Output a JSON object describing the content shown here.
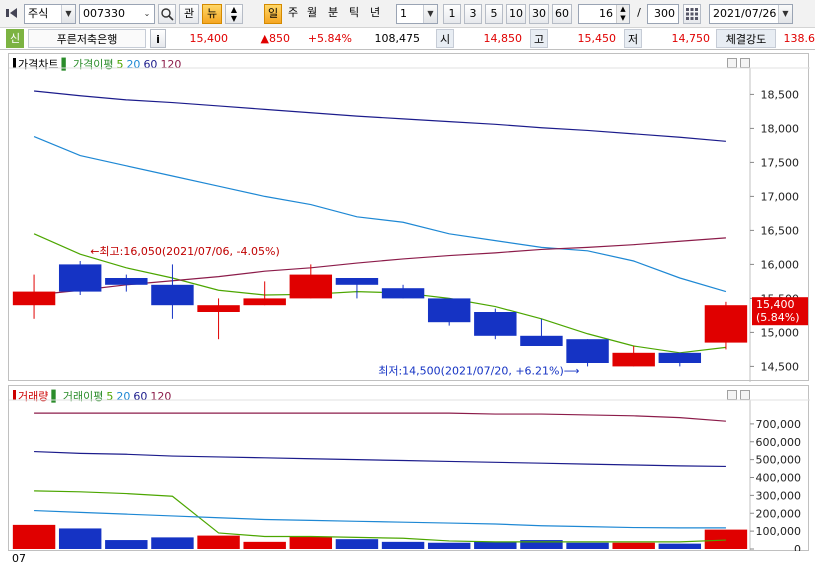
{
  "toolbar": {
    "market_type": "주식",
    "stock_code": "007330",
    "search_icon": "search-icon",
    "btn_gwan": "관",
    "btn_nyu": "뉴",
    "period_tabs": [
      {
        "label": "일",
        "active": true
      },
      {
        "label": "주",
        "active": false
      },
      {
        "label": "월",
        "active": false
      },
      {
        "label": "분",
        "active": false
      },
      {
        "label": "틱",
        "active": false
      },
      {
        "label": "년",
        "active": false
      }
    ],
    "interval_value": "1",
    "interval_buttons": [
      "1",
      "3",
      "5",
      "10",
      "30",
      "60"
    ],
    "count_value": "16",
    "slash": "/",
    "total_value": "300",
    "date_value": "2021/07/26"
  },
  "quote": {
    "badge": "신",
    "stock_name": "푸른저축은행",
    "info_button": "i",
    "price": "15,400",
    "change": "▲850",
    "change_rate": "+5.84%",
    "volume": "108,475",
    "open_label": "시",
    "open_value": "14,850",
    "high_label": "고",
    "high_value": "15,450",
    "low_label": "저",
    "low_value": "14,750",
    "strength_label": "체결강도",
    "strength_value": "138.6"
  },
  "price_chart": {
    "legend": {
      "title": "가격차트",
      "ma_label": "가격이평",
      "ma_periods": [
        "5",
        "20",
        "60",
        "120"
      ]
    },
    "y_ticks": [
      "18,500",
      "18,000",
      "17,500",
      "17,000",
      "16,500",
      "16,000",
      "15,500",
      "15,000",
      "14,500"
    ],
    "current_price_label": "15,400",
    "current_rate_label": "(5.84%)",
    "high_annotation": "←최고:16,050(2021/07/06, -4.05%)",
    "low_annotation": "최저:14,500(2021/07/20, +6.21%)⟶"
  },
  "volume_chart": {
    "legend": {
      "title": "거래량",
      "ma_label": "거래이평",
      "ma_periods": [
        "5",
        "20",
        "60",
        "120"
      ]
    },
    "y_ticks": [
      "700,000",
      "600,000",
      "500,000",
      "400,000",
      "300,000",
      "200,000",
      "100,000",
      "0"
    ]
  },
  "x_axis": {
    "month_label": "07"
  },
  "chart_data": {
    "type": "candlestick",
    "y_range": [
      14300,
      18800
    ],
    "candles": [
      {
        "open": 15400,
        "high": 15850,
        "low": 15200,
        "close": 15600,
        "volume": 135000
      },
      {
        "open": 16000,
        "high": 16050,
        "low": 15550,
        "close": 15600,
        "volume": 115000
      },
      {
        "open": 15800,
        "high": 15850,
        "low": 15600,
        "close": 15700,
        "volume": 50000
      },
      {
        "open": 15700,
        "high": 16000,
        "low": 15200,
        "close": 15400,
        "volume": 65000
      },
      {
        "open": 15300,
        "high": 15500,
        "low": 14900,
        "close": 15400,
        "volume": 75000
      },
      {
        "open": 15400,
        "high": 15750,
        "low": 15400,
        "close": 15500,
        "volume": 40000
      },
      {
        "open": 15500,
        "high": 16000,
        "low": 15500,
        "close": 15850,
        "volume": 70000
      },
      {
        "open": 15800,
        "high": 15800,
        "low": 15500,
        "close": 15700,
        "volume": 55000
      },
      {
        "open": 15650,
        "high": 15700,
        "low": 15500,
        "close": 15500,
        "volume": 40000
      },
      {
        "open": 15500,
        "high": 15500,
        "low": 15100,
        "close": 15150,
        "volume": 35000
      },
      {
        "open": 15300,
        "high": 15350,
        "low": 14900,
        "close": 14950,
        "volume": 40000
      },
      {
        "open": 14950,
        "high": 15200,
        "low": 14800,
        "close": 14800,
        "volume": 50000
      },
      {
        "open": 14900,
        "high": 14900,
        "low": 14500,
        "close": 14550,
        "volume": 35000
      },
      {
        "open": 14500,
        "high": 14800,
        "low": 14500,
        "close": 14700,
        "volume": 35000
      },
      {
        "open": 14700,
        "high": 14700,
        "low": 14500,
        "close": 14550,
        "volume": 30000
      },
      {
        "open": 14850,
        "high": 15450,
        "low": 14750,
        "close": 15400,
        "volume": 108475
      }
    ],
    "price_ma": {
      "ma5": [
        16450,
        16150,
        15950,
        15800,
        15620,
        15550,
        15560,
        15600,
        15580,
        15500,
        15380,
        15200,
        14980,
        14800,
        14700,
        14780
      ],
      "ma20": [
        17880,
        17600,
        17450,
        17300,
        17150,
        17000,
        16880,
        16700,
        16620,
        16450,
        16350,
        16250,
        16200,
        16050,
        15800,
        15600
      ],
      "ma60": [
        18550,
        18480,
        18420,
        18380,
        18330,
        18280,
        18230,
        18180,
        18140,
        18100,
        18060,
        18010,
        17970,
        17920,
        17870,
        17810
      ],
      "ma120": [
        15550,
        15620,
        15700,
        15760,
        15820,
        15900,
        15950,
        16020,
        16080,
        16130,
        16170,
        16220,
        16250,
        16290,
        16340,
        16390
      ]
    },
    "volume_ma": {
      "ma5": [
        325000,
        320000,
        310000,
        295000,
        90000,
        70000,
        70000,
        65000,
        60000,
        45000,
        40000,
        40000,
        40000,
        40000,
        40000,
        50000
      ],
      "ma20": [
        215000,
        205000,
        195000,
        185000,
        175000,
        165000,
        160000,
        155000,
        150000,
        145000,
        140000,
        130000,
        125000,
        120000,
        118000,
        118000
      ],
      "ma60": [
        545000,
        535000,
        530000,
        520000,
        515000,
        510000,
        505000,
        500000,
        495000,
        490000,
        485000,
        480000,
        475000,
        470000,
        465000,
        462000
      ],
      "ma120": [
        760000,
        760000,
        760000,
        760000,
        760000,
        760000,
        760000,
        760000,
        760000,
        760000,
        755000,
        755000,
        750000,
        745000,
        735000,
        715000
      ]
    },
    "volume_range": [
      0,
      800000
    ],
    "colors": {
      "up": "#e00000",
      "down": "#1533c4",
      "ma5": "#4ca600",
      "ma20": "#1e88d4",
      "ma60": "#1c1c8c",
      "ma120": "#8c1c4a"
    }
  }
}
